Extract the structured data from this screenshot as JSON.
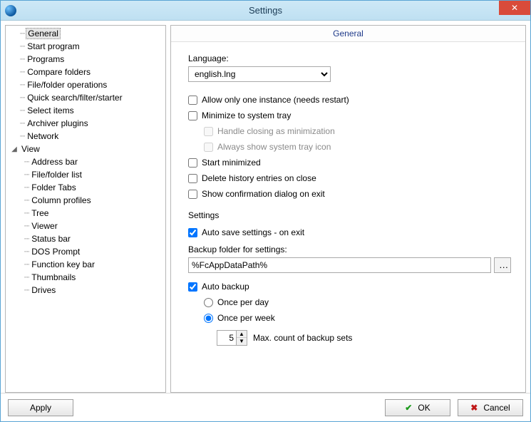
{
  "window": {
    "title": "Settings"
  },
  "tree": {
    "items": [
      {
        "label": "General",
        "selected": true
      },
      {
        "label": "Start program"
      },
      {
        "label": "Programs"
      },
      {
        "label": "Compare folders"
      },
      {
        "label": "File/folder operations"
      },
      {
        "label": "Quick search/filter/starter"
      },
      {
        "label": "Select items"
      },
      {
        "label": "Archiver plugins"
      },
      {
        "label": "Network"
      }
    ],
    "view": {
      "label": "View",
      "expanded": true,
      "children": [
        {
          "label": "Address bar"
        },
        {
          "label": "File/folder list"
        },
        {
          "label": "Folder Tabs"
        },
        {
          "label": "Column profiles"
        },
        {
          "label": "Tree"
        },
        {
          "label": "Viewer"
        },
        {
          "label": "Status bar"
        },
        {
          "label": "DOS Prompt"
        },
        {
          "label": "Function key bar"
        },
        {
          "label": "Thumbnails"
        },
        {
          "label": "Drives"
        }
      ]
    }
  },
  "panel": {
    "header": "General",
    "language_label": "Language:",
    "language_value": "english.lng",
    "cb_one_instance": "Allow only one instance (needs restart)",
    "cb_min_tray": "Minimize to system tray",
    "cb_handle_close": "Handle closing as minimization",
    "cb_always_tray": "Always show system tray icon",
    "cb_start_min": "Start minimized",
    "cb_delete_history": "Delete history entries on close",
    "cb_confirm_exit": "Show confirmation dialog on exit",
    "settings_group": "Settings",
    "cb_autosave": "Auto save settings - on exit",
    "backup_folder_label": "Backup folder for settings:",
    "backup_folder_value": "%FcAppDataPath%",
    "cb_autobackup": "Auto backup",
    "rb_once_day": "Once per day",
    "rb_once_week": "Once per week",
    "spin_value": "5",
    "spin_label": "Max. count of backup sets"
  },
  "footer": {
    "apply": "Apply",
    "ok": "OK",
    "cancel": "Cancel"
  }
}
